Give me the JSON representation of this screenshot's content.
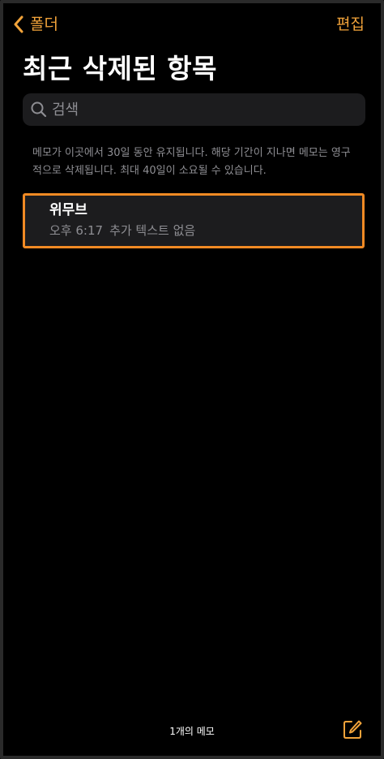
{
  "nav": {
    "back_label": "폴더",
    "edit_label": "편집"
  },
  "page": {
    "title": "최근 삭제된 항목"
  },
  "search": {
    "placeholder": "검색"
  },
  "info": {
    "text": "메모가 이곳에서 30일 동안 유지됩니다. 해당 기간이 지나면 메모는 영구적으로 삭제됩니다. 최대 40일이 소요될 수 있습니다."
  },
  "notes": [
    {
      "title": "위무브",
      "time": "오후 6:17",
      "preview": "추가 텍스트 없음"
    }
  ],
  "toolbar": {
    "count_label": "1개의 메모"
  },
  "colors": {
    "accent": "#f2a33a",
    "selection_border": "#f08a24",
    "background": "#000000",
    "cell_background": "#1c1c1e",
    "secondary_text": "#8e8e93"
  },
  "icons": {
    "back": "chevron-left-icon",
    "search": "search-icon",
    "compose": "compose-icon"
  }
}
